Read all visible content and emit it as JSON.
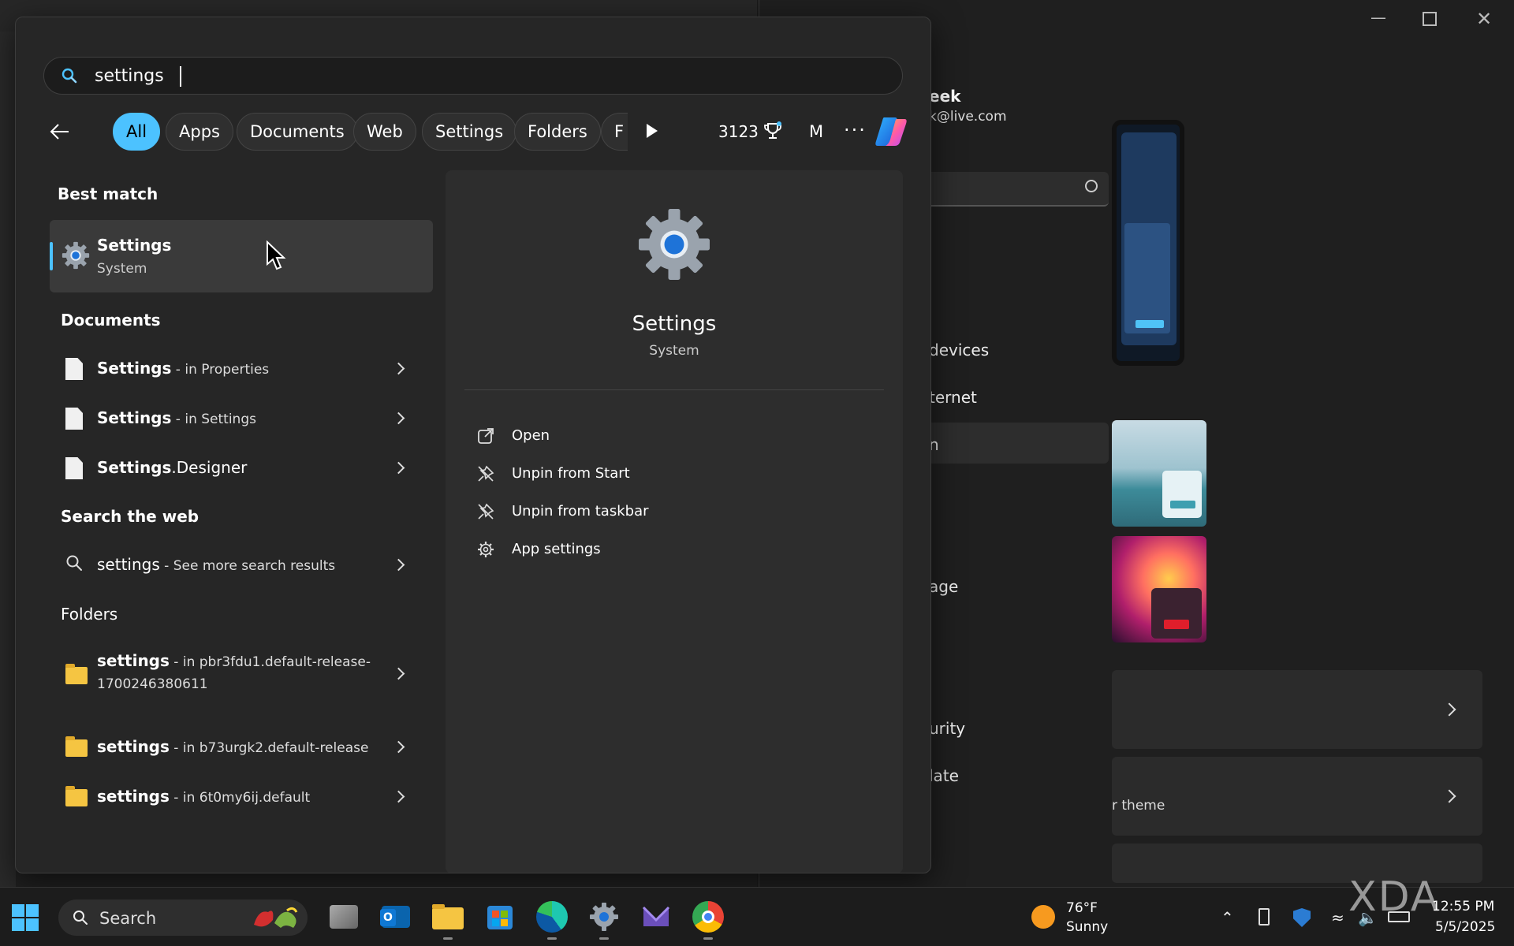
{
  "search": {
    "query": "settings"
  },
  "filters": {
    "items": [
      "All",
      "Apps",
      "Documents",
      "Web",
      "Settings",
      "Folders",
      "F"
    ],
    "points": "3123",
    "avatar_initial": "M",
    "more": "···"
  },
  "best_match": {
    "heading": "Best match",
    "title": "Settings",
    "subtitle": "System"
  },
  "documents": {
    "heading": "Documents",
    "items": [
      {
        "name": "Settings",
        "sub": " - in Properties"
      },
      {
        "name": "Settings",
        "sub": " - in Settings"
      },
      {
        "name": "Settings",
        "sub": ".Designer"
      }
    ]
  },
  "web": {
    "heading": "Search the web",
    "item": {
      "name": "settings",
      "sub": " - See more search results"
    }
  },
  "folders": {
    "heading": "Folders",
    "items": [
      {
        "name": "settings",
        "sub": " - in pbr3fdu1.default-release-",
        "line2": "1700246380611"
      },
      {
        "name": "settings",
        "sub": " - in b73urgk2.default-release"
      },
      {
        "name": "settings",
        "sub": " - in 6t0my6ij.default"
      }
    ]
  },
  "detail": {
    "name": "Settings",
    "category": "System",
    "actions": [
      "Open",
      "Unpin from Start",
      "Unpin from taskbar",
      "App settings"
    ]
  },
  "background_window": {
    "account_name": "eek",
    "account_mail": "k@live.com",
    "nav_fragments": [
      "devices",
      "ternet",
      "n",
      "age",
      "urity",
      "late"
    ],
    "card_fragment": "r theme"
  },
  "taskbar": {
    "search_label": "Search",
    "weather_temp": "76°F",
    "weather_desc": "Sunny",
    "time": "12:55 PM",
    "date": "5/5/2025"
  },
  "watermark": "XDA",
  "colors": {
    "accent": "#4cc2ff",
    "panel": "#262626",
    "detail": "#2d2d2d"
  }
}
